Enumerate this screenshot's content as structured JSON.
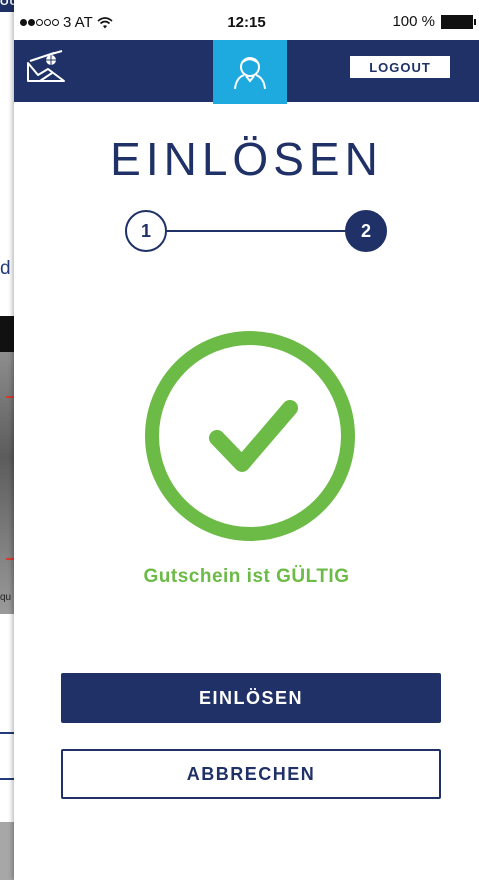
{
  "status_bar": {
    "carrier": "3 AT",
    "time": "12:15",
    "battery": "100 %",
    "signal_dots_filled": 2,
    "signal_dots_total": 5
  },
  "background_screen": {
    "top_label": "OUT",
    "link_fragment": "d",
    "caption_fragment": "qu"
  },
  "navbar": {
    "logo_icon": "mountain-sun-logo-icon",
    "profile_icon": "user-icon",
    "logout_label": "LOGOUT"
  },
  "page": {
    "title": "EINLÖSEN"
  },
  "stepper": {
    "steps": [
      {
        "label": "1",
        "state": "done"
      },
      {
        "label": "2",
        "state": "active"
      }
    ]
  },
  "result": {
    "icon": "checkmark-circle-icon",
    "message": "Gutschein ist GÜLTIG"
  },
  "actions": {
    "primary_label": "EINLÖSEN",
    "secondary_label": "ABBRECHEN"
  },
  "colors": {
    "navy": "#1f3166",
    "accent_blue": "#1eaadf",
    "success_green": "#6dbb47"
  }
}
